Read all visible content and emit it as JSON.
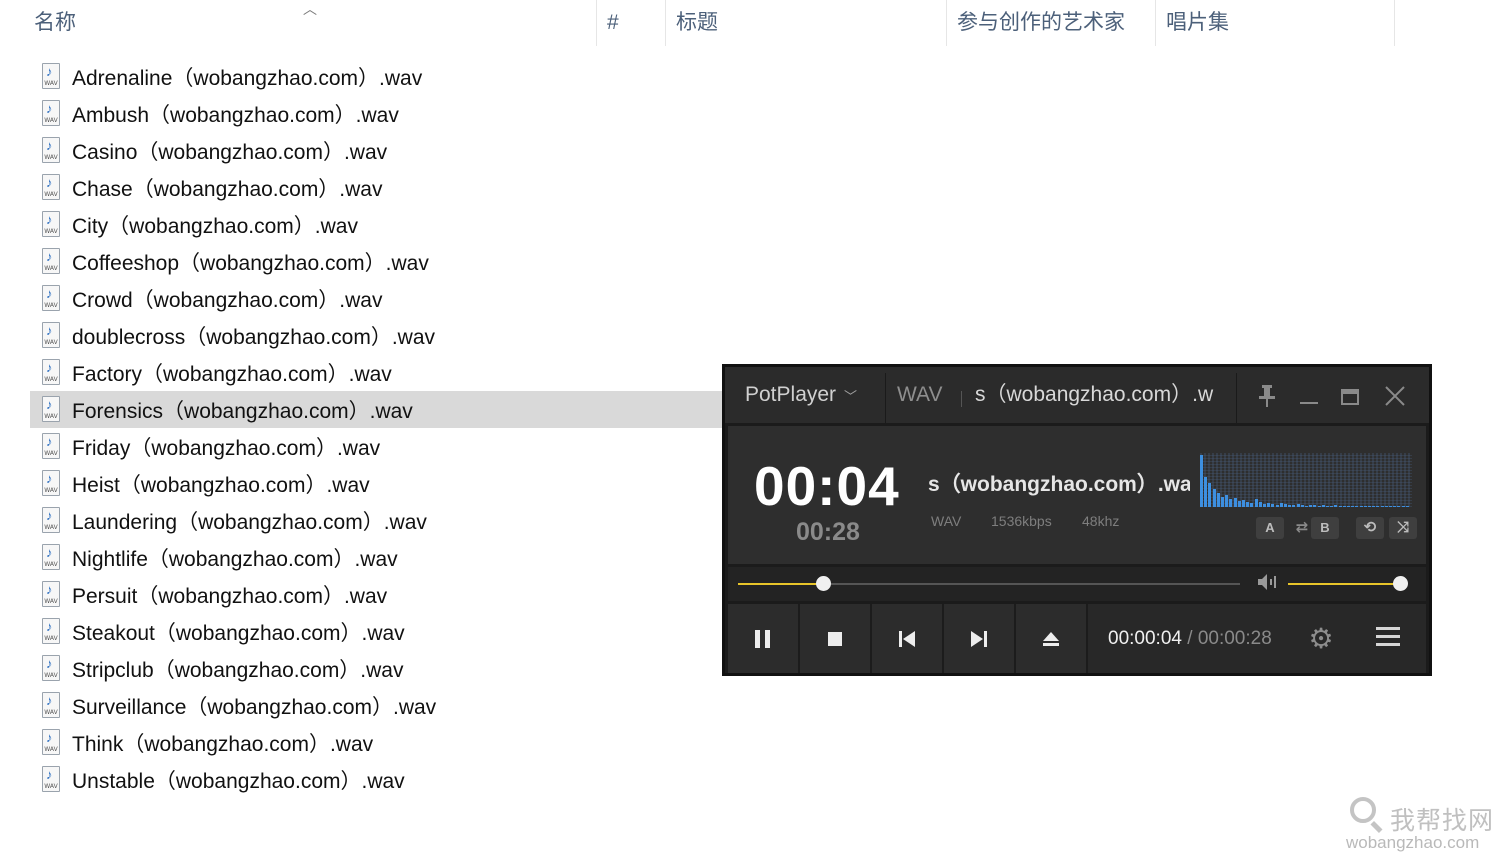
{
  "explorer": {
    "columns": {
      "name": "名称",
      "number": "#",
      "title": "标题",
      "artist": "参与创作的艺术家",
      "album": "唱片集"
    },
    "files": [
      {
        "name": "Adrenaline（wobangzhao.com）.wav",
        "selected": false
      },
      {
        "name": "Ambush（wobangzhao.com）.wav",
        "selected": false
      },
      {
        "name": "Casino（wobangzhao.com）.wav",
        "selected": false
      },
      {
        "name": "Chase（wobangzhao.com）.wav",
        "selected": false
      },
      {
        "name": "City（wobangzhao.com）.wav",
        "selected": false
      },
      {
        "name": "Coffeeshop（wobangzhao.com）.wav",
        "selected": false
      },
      {
        "name": "Crowd（wobangzhao.com）.wav",
        "selected": false
      },
      {
        "name": "doublecross（wobangzhao.com）.wav",
        "selected": false
      },
      {
        "name": "Factory（wobangzhao.com）.wav",
        "selected": false
      },
      {
        "name": "Forensics（wobangzhao.com）.wav",
        "selected": true
      },
      {
        "name": "Friday（wobangzhao.com）.wav",
        "selected": false
      },
      {
        "name": "Heist（wobangzhao.com）.wav",
        "selected": false
      },
      {
        "name": "Laundering（wobangzhao.com）.wav",
        "selected": false
      },
      {
        "name": "Nightlife（wobangzhao.com）.wav",
        "selected": false
      },
      {
        "name": "Persuit（wobangzhao.com）.wav",
        "selected": false
      },
      {
        "name": "Steakout（wobangzhao.com）.wav",
        "selected": false
      },
      {
        "name": "Stripclub（wobangzhao.com）.wav",
        "selected": false
      },
      {
        "name": "Surveillance（wobangzhao.com）.wav",
        "selected": false
      },
      {
        "name": "Think（wobangzhao.com）.wav",
        "selected": false
      },
      {
        "name": "Unstable（wobangzhao.com）.wav",
        "selected": false
      }
    ],
    "file_icon": "wav-audio-file-icon",
    "file_icon_label": "WAV"
  },
  "player": {
    "app_name": "PotPlayer",
    "format": "WAV",
    "title_scroll": "s（wobangzhao.com）.w",
    "current_time": "00:04",
    "total_time": "00:28",
    "track_scroll": "s（wobangzhao.com）.wa",
    "meta": {
      "format": "WAV",
      "bitrate": "1536kbps",
      "samplerate": "48khz"
    },
    "mini_buttons": {
      "a": "A",
      "b": "B"
    },
    "seek_fraction": 0.17,
    "volume_fraction": 1.0,
    "playback_time": "00:00:04",
    "playback_sep": "/",
    "playback_total": "00:00:28",
    "accent_color": "#e7c42a"
  },
  "watermark": {
    "zh": "我帮找网",
    "en": "wobangzhao.com"
  }
}
